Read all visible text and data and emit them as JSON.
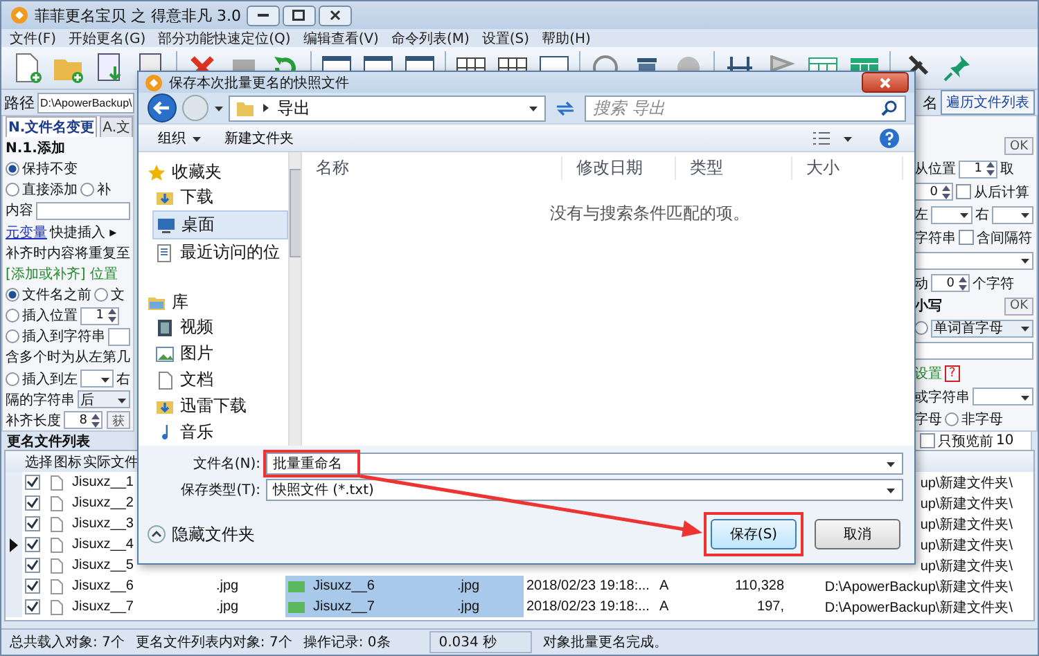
{
  "window": {
    "title": "菲菲更名宝贝 之 得意非凡 3.0"
  },
  "menu": [
    "文件(F)",
    "开始更名(G)",
    "部分功能快速定位(Q)",
    "编辑查看(V)",
    "命令列表(M)",
    "设置(S)",
    "帮助(H)"
  ],
  "path": {
    "label": "路径",
    "value": "D:\\ApowerBackup\\"
  },
  "right_header": {
    "label": "名",
    "button": "遍历文件列表"
  },
  "left_panel": {
    "tabs": [
      {
        "label": "N.文件名变更",
        "selected": true
      },
      {
        "label": "A.文",
        "selected": false
      }
    ],
    "rows": [
      [
        {
          "kind": "bold",
          "text": "N.1.添加"
        }
      ],
      [
        {
          "kind": "radio",
          "text": "保持不变",
          "selected": true
        }
      ],
      [
        {
          "kind": "radio",
          "text": "直接添加",
          "selected": false
        },
        {
          "kind": "radio",
          "text": "补",
          "selected": false
        }
      ],
      [
        {
          "kind": "text",
          "text": "内容"
        },
        {
          "kind": "field"
        }
      ],
      [
        {
          "kind": "link",
          "text": "元变量"
        },
        {
          "kind": "text",
          "text": "快捷插入 ▸"
        }
      ],
      [
        {
          "kind": "text",
          "text": "补齐时内容将重复至"
        }
      ],
      [
        {
          "kind": "green",
          "text": "[添加或补齐] 位置"
        }
      ],
      [
        {
          "kind": "radio",
          "text": "文件名之前",
          "selected": true
        },
        {
          "kind": "radio",
          "text": "文",
          "selected": false
        }
      ],
      [
        {
          "kind": "radio",
          "text": "插入位置",
          "selected": false
        },
        {
          "kind": "spin",
          "value": "1"
        }
      ],
      [
        {
          "kind": "radio",
          "text": "插入到字符串",
          "selected": false
        },
        {
          "kind": "field"
        }
      ],
      [
        {
          "kind": "text",
          "text": "含多个时为从左第几"
        }
      ],
      [
        {
          "kind": "radio",
          "text": "插入到左",
          "selected": false
        },
        {
          "kind": "drop"
        },
        {
          "kind": "text",
          "text": "右"
        }
      ],
      [
        {
          "kind": "text",
          "text": "隔的字符串"
        },
        {
          "kind": "drop",
          "value": "后"
        }
      ],
      [
        {
          "kind": "text",
          "text": "补齐长度"
        },
        {
          "kind": "spin",
          "value": "8"
        },
        {
          "kind": "button",
          "text": "获"
        }
      ]
    ]
  },
  "right_panel": {
    "rows": [
      [
        {
          "kind": "button",
          "text": "OK"
        }
      ],
      [
        {
          "kind": "text",
          "text": "从位置"
        },
        {
          "kind": "spin",
          "value": "1"
        },
        {
          "kind": "text",
          "text": "取"
        }
      ],
      [
        {
          "kind": "spin",
          "value": "0"
        },
        {
          "kind": "check",
          "text": "从后计算",
          "checked": false
        }
      ],
      [
        {
          "kind": "text",
          "text": "左"
        },
        {
          "kind": "drop"
        },
        {
          "kind": "text",
          "text": "右"
        },
        {
          "kind": "drop"
        }
      ],
      [
        {
          "kind": "text",
          "text": "字符串"
        },
        {
          "kind": "check",
          "text": "含间隔符",
          "checked": false
        }
      ],
      [
        {
          "kind": "drop"
        }
      ],
      [
        {
          "kind": "text",
          "text": "动"
        },
        {
          "kind": "spin",
          "value": "0"
        },
        {
          "kind": "text",
          "text": "个字符"
        }
      ],
      [
        {
          "kind": "bold",
          "text": "小写"
        },
        {
          "kind": "button",
          "text": "OK"
        }
      ],
      [
        {
          "kind": "radio",
          "selected": false
        },
        {
          "kind": "drop",
          "value": "单词首字母"
        }
      ],
      [
        {
          "kind": "field"
        }
      ],
      [
        {
          "kind": "green",
          "text": "设置"
        },
        {
          "kind": "help",
          "text": "?"
        }
      ],
      [
        {
          "kind": "text",
          "text": "或字符串"
        },
        {
          "kind": "drop"
        }
      ],
      [
        {
          "kind": "text",
          "text": "字母"
        },
        {
          "kind": "radio",
          "text": "非字母",
          "selected": false
        }
      ]
    ]
  },
  "file_list": {
    "title": "更名文件列表",
    "preview_limit": {
      "label": "只预览前",
      "checked": false,
      "value": "10"
    },
    "columns": [
      "选择",
      "图标",
      "实际文件"
    ],
    "rows": [
      {
        "current": false,
        "checked": true,
        "name": "Jisuxz__1",
        "path": "up\\新建文件夹\\"
      },
      {
        "current": false,
        "checked": true,
        "name": "Jisuxz__2",
        "path": "up\\新建文件夹\\"
      },
      {
        "current": false,
        "checked": true,
        "name": "Jisuxz__3",
        "path": "up\\新建文件夹\\"
      },
      {
        "current": true,
        "checked": true,
        "name": "Jisuxz__4",
        "path": "up\\新建文件夹\\"
      },
      {
        "current": false,
        "checked": true,
        "name": "Jisuxz__5",
        "path": "up\\新建文件夹\\"
      },
      {
        "current": false,
        "checked": true,
        "name": "Jisuxz__6",
        "ext": ".jpg",
        "new_name": "Jisuxz__6",
        "new_ext": ".jpg",
        "modified": "2018/02/23 19:18:...",
        "attr": "A",
        "size": "110,328",
        "path": "D:\\ApowerBackup\\新建文件夹\\"
      },
      {
        "current": false,
        "checked": true,
        "name": "Jisuxz__7",
        "ext": ".jpg",
        "new_name": "Jisuxz__7",
        "new_ext": ".jpg",
        "modified": "2018/02/23 19:18:...",
        "attr": "A",
        "size": "197,",
        "path": "D:\\ApowerBackup\\新建文件夹\\"
      }
    ]
  },
  "status_bar": {
    "items": [
      "总共载入对象: 7个",
      "更名文件列表内对象: 7个",
      "操作记录: 0条"
    ],
    "time": "0.034 秒",
    "message": "对象批量更名完成。"
  },
  "dialog": {
    "title": "保存本次批量更名的快照文件",
    "address": "导出",
    "search": {
      "placeholder": "搜索 导出"
    },
    "organize": "组织",
    "new_folder": "新建文件夹",
    "nav": [
      {
        "label": "收藏夹",
        "kind": "star",
        "selected": false,
        "children": [
          {
            "label": "下载",
            "kind": "download",
            "selected": false
          },
          {
            "label": "桌面",
            "kind": "desktop",
            "selected": true
          },
          {
            "label": "最近访问的位",
            "kind": "recent",
            "selected": false
          }
        ]
      },
      {
        "label": "库",
        "kind": "library",
        "selected": false,
        "children": [
          {
            "label": "视频",
            "kind": "video",
            "selected": false
          },
          {
            "label": "图片",
            "kind": "image",
            "selected": false
          },
          {
            "label": "文档",
            "kind": "document",
            "selected": false
          },
          {
            "label": "迅雷下载",
            "kind": "download",
            "selected": false
          },
          {
            "label": "音乐",
            "kind": "music",
            "selected": false
          }
        ]
      }
    ],
    "columns": [
      "名称",
      "修改日期",
      "类型",
      "大小"
    ],
    "empty_message": "没有与搜索条件匹配的项。",
    "file_name": {
      "label": "文件名(N):",
      "value": "批量重命名",
      "highlighted": true
    },
    "file_type": {
      "label": "保存类型(T):",
      "value": "快照文件 (*.txt)"
    },
    "hide_folders": "隐藏文件夹",
    "buttons": [
      {
        "label": "保存(S)",
        "kind": "primary",
        "highlighted": true
      },
      {
        "label": "取消",
        "kind": "cancel",
        "highlighted": false
      }
    ]
  }
}
